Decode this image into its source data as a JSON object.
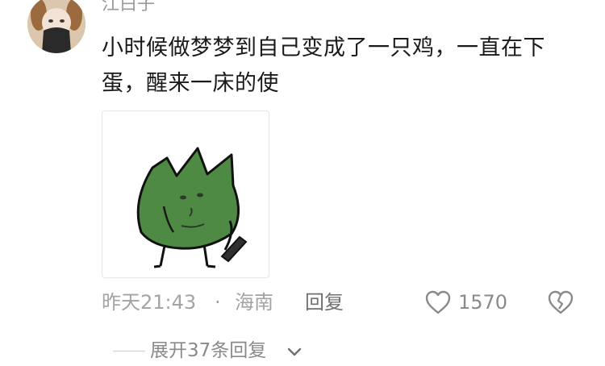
{
  "comment": {
    "username": "江白子",
    "text": "小时候做梦梦到自己变成了一只鸡，一直在下蛋，醒来一床的使",
    "sticker_icon": "green-leaf-creature-sticker"
  },
  "meta": {
    "time": "昨天21:43",
    "separator": "·",
    "location": "海南",
    "reply_label": "回复",
    "like_count": "1570",
    "like_icon": "heart-outline-icon",
    "dislike_icon": "broken-heart-icon"
  },
  "replies": {
    "expand_label": "展开37条回复",
    "chevron_icon": "chevron-down-icon"
  },
  "colors": {
    "text": "#1a1a1a",
    "muted": "#a3a3a3",
    "sticker_green": "#4f8a45"
  }
}
